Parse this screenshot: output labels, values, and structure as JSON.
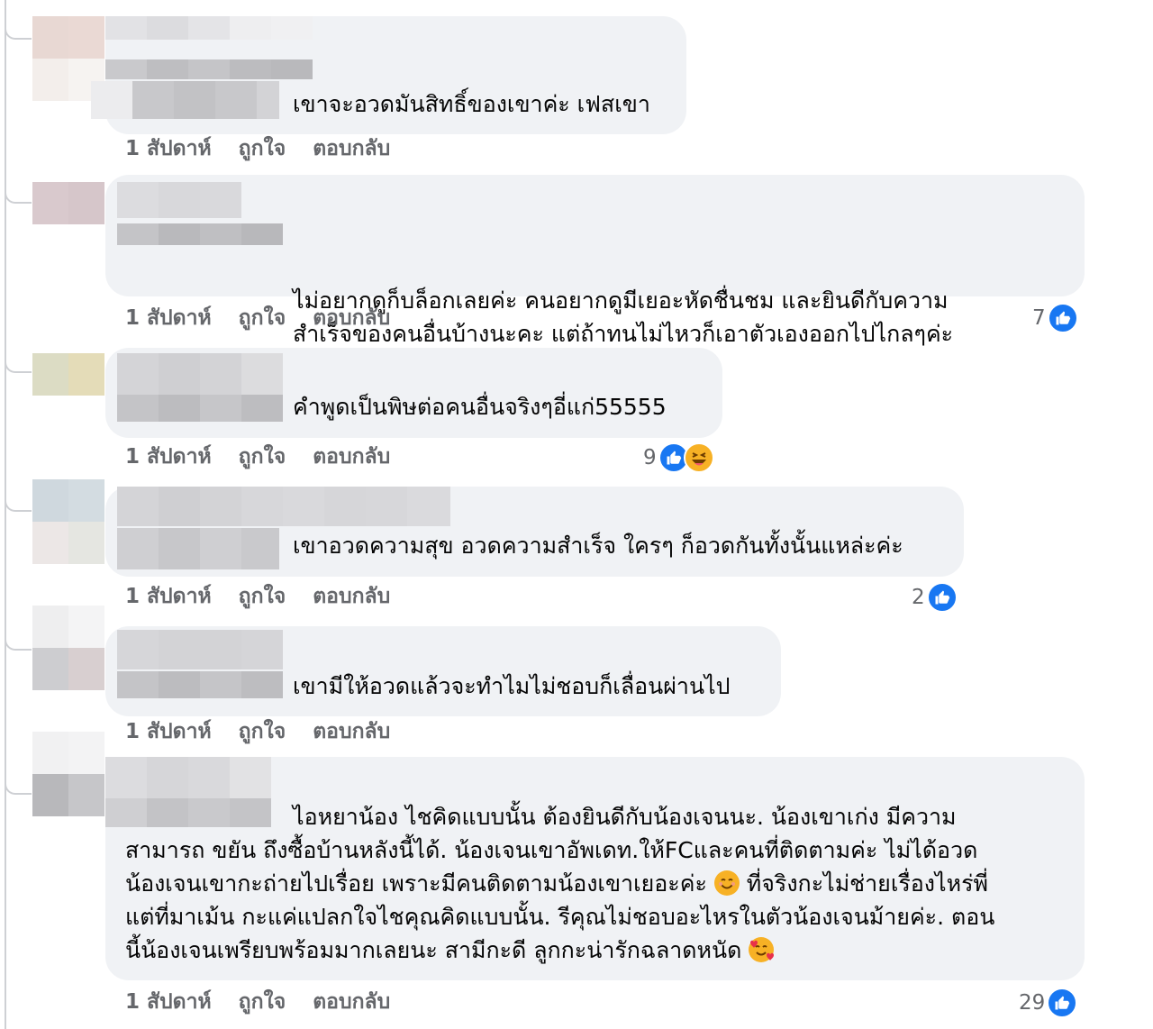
{
  "colors": {
    "bubble": "#f0f2f5",
    "text": "#050505",
    "meta": "#65676b",
    "like": "#1877f2",
    "haha": "#f7b125"
  },
  "action_labels": {
    "time": "1 สัปดาห์",
    "like": "ถูกใจ",
    "reply": "ตอบกลับ"
  },
  "comments": [
    {
      "text": "เขาจะอวดมันสิทธิ์ของเขาค่ะ เฟสเขา",
      "reaction_count": "",
      "reactions": []
    },
    {
      "text": "ไม่อยากดูก็บล็อกเลยค่ะ คนอยากดูมีเยอะหัดชื่นชม และยินดีกับความ\nสำเร็จของคนอื่นบ้างนะคะ แต่ถ้าทนไม่ไหวก็เอาตัวเองออกไปไกลๆค่ะ",
      "reaction_count": "7",
      "reactions": [
        "like-icon"
      ]
    },
    {
      "text": "คำพูดเป็นพิษต่อคนอื่นจริงๆอี่แก่55555",
      "reaction_count": "9",
      "reactions": [
        "like-icon",
        "haha-icon"
      ]
    },
    {
      "text": "เขาอวดความสุข อวดความสำเร็จ ใครๆ ก็อวดกันทั้งนั้นแหล่ะค่ะ",
      "reaction_count": "2",
      "reactions": [
        "like-icon"
      ]
    },
    {
      "text": "เขามีให้อวดแล้วจะทำไมไม่ชอบก็เลื่อนผ่านไป",
      "reaction_count": "",
      "reactions": []
    },
    {
      "text_parts": {
        "line1": "ไอหยาน้อง ไชคิดแบบนั้น ต้องยินดีกับน้องเจนนะ. น้องเขาเก่ง มีความ",
        "line2": "สามารถ ขยัน ถึงซื้อบ้านหลังนี้ได้. น้องเจนเขาอัพเดท.ให้FCและคนที่ติดตามค่ะ ไม่ได้อวด",
        "line3a": "น้องเจนเขากะถ่ายไปเรื่อย เพราะมีคนติดตามน้องเขาเยอะค่ะ ",
        "line3b": " ที่จริงกะไม่ช่ายเรื่องไหร่พี่",
        "line4": "แต่ที่มาเม้น กะแค่แปลกใจไชคุณคิดแบบนั้น. รีคุณไม่ชอบอะไหรในตัวน้องเจนม้ายค่ะ. ตอน",
        "line5": "นี้น้องเจนเพรียบพร้อมมากเลยนะ สามีกะดี ลูกกะน่ารักฉลาดหนัด "
      },
      "inline_emojis": [
        "smiling-face-icon",
        "smiling-face-with-hearts-icon"
      ],
      "reaction_count": "29",
      "reactions": [
        "like-icon"
      ]
    }
  ]
}
